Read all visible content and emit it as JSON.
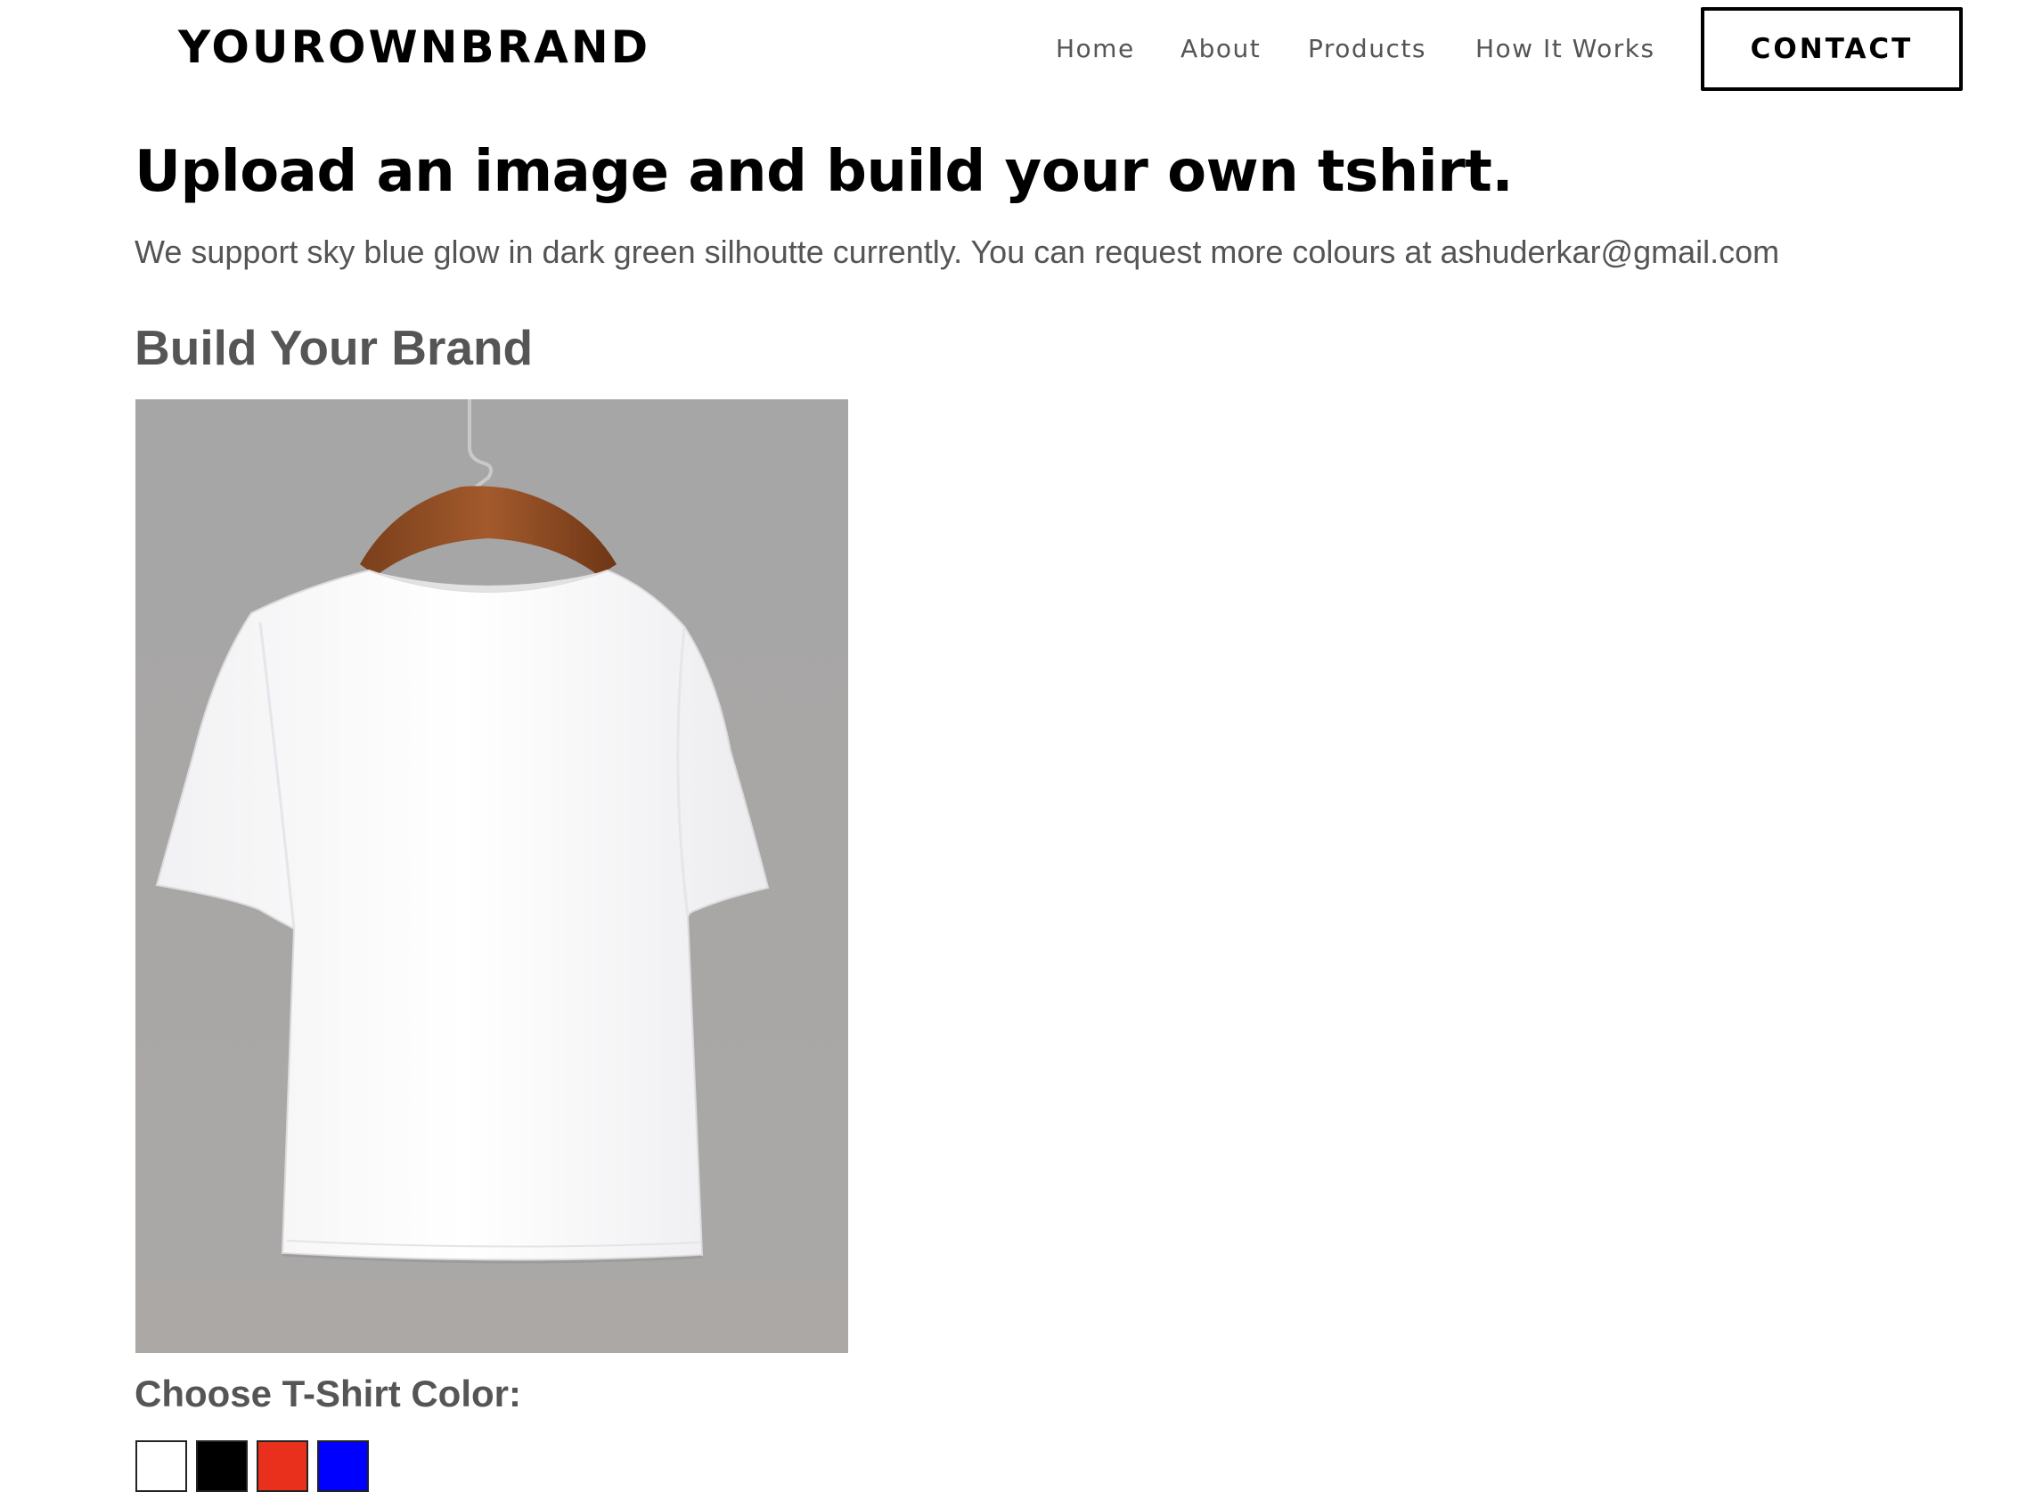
{
  "header": {
    "brand": "YOUROWNBRAND",
    "nav": {
      "home": "Home",
      "about": "About",
      "products": "Products",
      "how_it_works": "How It Works"
    },
    "contact_label": "CONTACT"
  },
  "main": {
    "title": "Upload an image and build your own tshirt.",
    "subtitle": "We support sky blue glow in dark green silhoutte currently. You can request more colours at ashuderkar@gmail.com",
    "section_heading": "Build Your Brand",
    "preview": {
      "icon": "tshirt-on-hanger-image",
      "tshirt_color": "#ffffff",
      "background_color": "#a8a8a8"
    },
    "color_label": "Choose T-Shirt Color:",
    "swatches": [
      {
        "name": "white",
        "color": "#ffffff"
      },
      {
        "name": "black",
        "color": "#000000"
      },
      {
        "name": "red",
        "color": "#e8301c"
      },
      {
        "name": "blue",
        "color": "#0000ff"
      }
    ]
  }
}
